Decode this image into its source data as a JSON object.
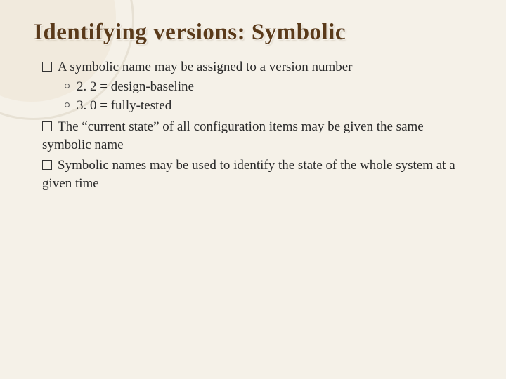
{
  "title": "Identifying versions: Symbolic",
  "b1": {
    "text": "A symbolic name may be assigned to a version number",
    "subs": [
      "2. 2 = design-baseline",
      "3. 0 = fully-tested"
    ]
  },
  "b2": {
    "text": "The “current state” of all configuration items may be given the same symbolic name"
  },
  "b3": {
    "text": "Symbolic names may be used to identify the state of the whole system at a given time"
  }
}
